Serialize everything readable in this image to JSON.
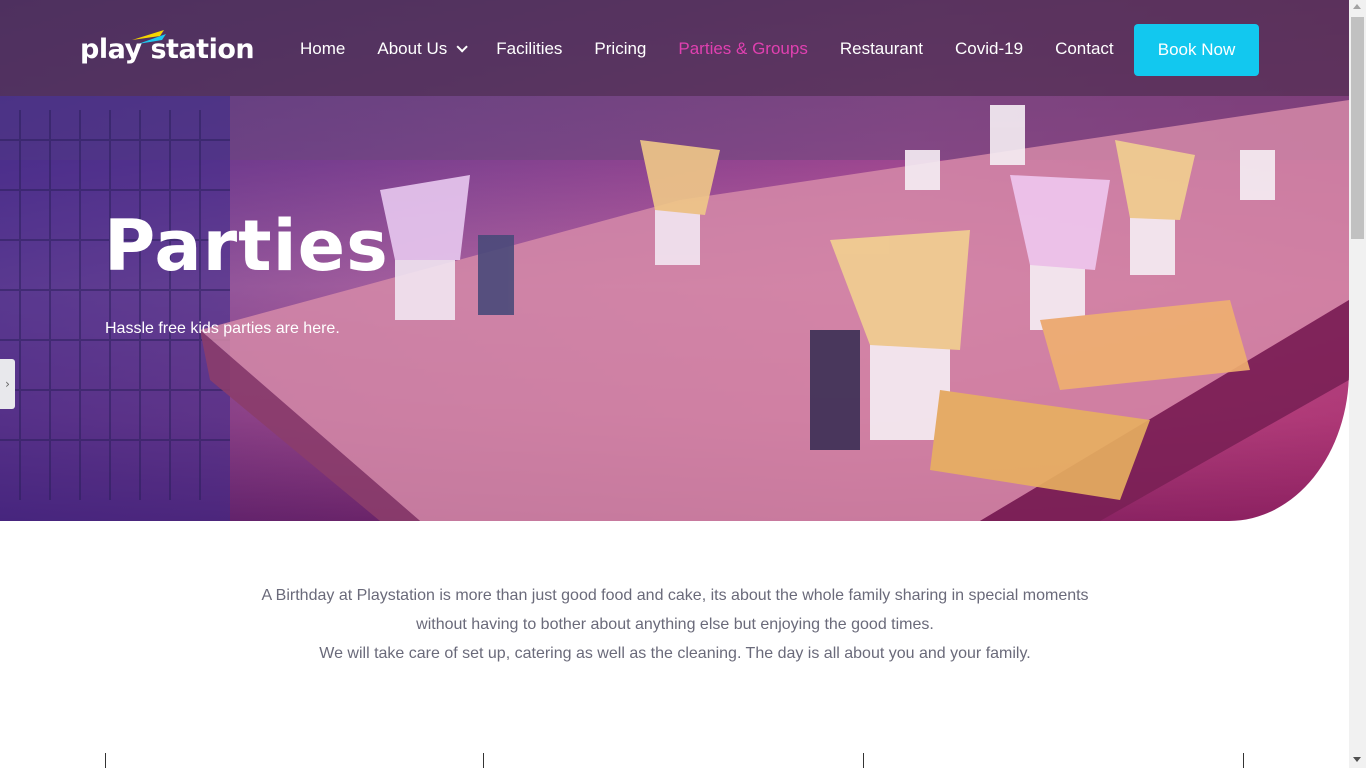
{
  "header": {
    "logo_text": "play station",
    "nav": [
      {
        "label": "Home",
        "active": false,
        "dropdown": false
      },
      {
        "label": "About Us",
        "active": false,
        "dropdown": true
      },
      {
        "label": "Facilities",
        "active": false,
        "dropdown": false
      },
      {
        "label": "Pricing",
        "active": false,
        "dropdown": false
      },
      {
        "label": "Parties & Groups",
        "active": true,
        "dropdown": false
      },
      {
        "label": "Restaurant",
        "active": false,
        "dropdown": false
      },
      {
        "label": "Covid-19",
        "active": false,
        "dropdown": false
      },
      {
        "label": "Contact",
        "active": false,
        "dropdown": false
      }
    ],
    "cta_label": "Book Now"
  },
  "hero": {
    "title": "Parties",
    "subtitle": "Hassle free kids parties are here."
  },
  "intro": {
    "line1": "A Birthday at Playstation is more than just good food and cake, its about the whole family sharing in special moments without having to bother about anything else but enjoying the good times.",
    "line2": "We will take care of set up, catering as well as the cleaning. The day is all about you and your family."
  },
  "colors": {
    "accent_cta": "#12c8ef",
    "active_nav": "#e040b0",
    "body_text": "#6a6a7a"
  },
  "icons": {
    "side_tab": "chevron-right-icon",
    "dropdown": "chevron-down-icon"
  }
}
